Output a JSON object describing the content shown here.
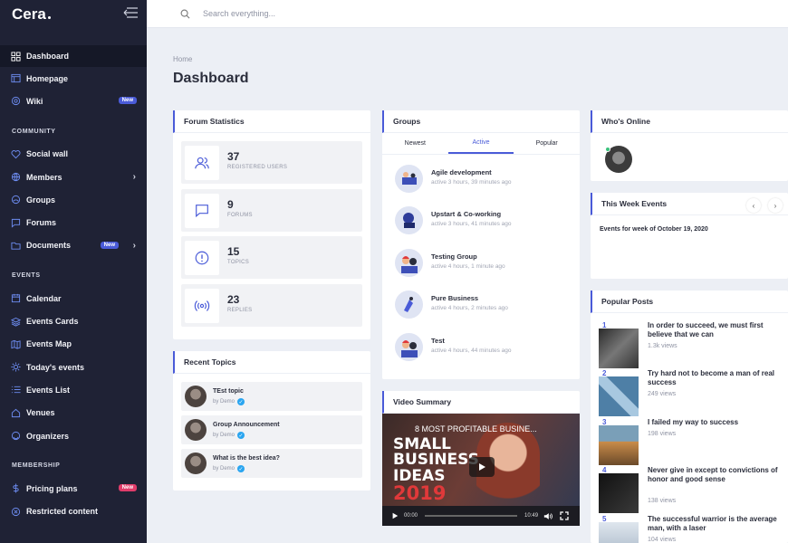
{
  "brand": {
    "name": "Cera"
  },
  "search": {
    "placeholder": "Search everything..."
  },
  "breadcrumb": "Home",
  "page_title": "Dashboard",
  "sidebar": {
    "top": [
      {
        "label": "Dashboard",
        "icon": "grid-icon",
        "active": true
      },
      {
        "label": "Homepage",
        "icon": "browser-icon"
      },
      {
        "label": "Wiki",
        "icon": "globe-icon",
        "badge": "New"
      }
    ],
    "community_title": "COMMUNITY",
    "community": [
      {
        "label": "Social wall",
        "icon": "heart-icon"
      },
      {
        "label": "Members",
        "icon": "globe-icon"
      },
      {
        "label": "Groups",
        "icon": "groups-icon"
      },
      {
        "label": "Forums",
        "icon": "chat-icon"
      },
      {
        "label": "Documents",
        "icon": "folder-icon",
        "badge": "New"
      }
    ],
    "events_title": "EVENTS",
    "events": [
      {
        "label": "Calendar",
        "icon": "calendar-icon"
      },
      {
        "label": "Events Cards",
        "icon": "layers-icon"
      },
      {
        "label": "Events Map",
        "icon": "map-icon"
      },
      {
        "label": "Today's events",
        "icon": "sun-icon"
      },
      {
        "label": "Events List",
        "icon": "list-icon"
      },
      {
        "label": "Venues",
        "icon": "home-icon"
      },
      {
        "label": "Organizers",
        "icon": "user-circle-icon"
      }
    ],
    "membership_title": "MEMBERSHIP",
    "membership": [
      {
        "label": "Pricing plans",
        "icon": "dollar-icon",
        "badge": "New"
      },
      {
        "label": "Restricted content",
        "icon": "close-circle-icon"
      }
    ]
  },
  "forum_stats": {
    "title": "Forum Statistics",
    "items": [
      {
        "value": "37",
        "label": "REGISTERED USERS",
        "icon": "users-icon"
      },
      {
        "value": "9",
        "label": "FORUMS",
        "icon": "chat-icon"
      },
      {
        "value": "15",
        "label": "TOPICS",
        "icon": "alert-circle-icon"
      },
      {
        "value": "23",
        "label": "REPLIES",
        "icon": "broadcast-icon"
      }
    ]
  },
  "recent_topics": {
    "title": "Recent Topics",
    "items": [
      {
        "title": "TEst topic",
        "by": "by Demo"
      },
      {
        "title": "Group Announcement",
        "by": "by Demo"
      },
      {
        "title": "What is the best idea?",
        "by": "by Demo"
      }
    ]
  },
  "groups": {
    "title": "Groups",
    "tabs": [
      "Newest",
      "Active",
      "Popular"
    ],
    "active_tab": "Active",
    "items": [
      {
        "name": "Agile development",
        "meta": "active 3 hours, 39 minutes ago"
      },
      {
        "name": "Upstart & Co-working",
        "meta": "active 3 hours, 41 minutes ago"
      },
      {
        "name": "Testing Group",
        "meta": "active 4 hours, 1 minute ago"
      },
      {
        "name": "Pure Business",
        "meta": "active 4 hours, 2 minutes ago"
      },
      {
        "name": "Test",
        "meta": "active 4 hours, 44 minutes ago"
      }
    ]
  },
  "video": {
    "title": "Video Summary",
    "video_title": "8 MOST PROFITABLE BUSINE...",
    "thumb_line1": "SMALL",
    "thumb_line2": "BUSINESS",
    "thumb_line3": "IDEAS",
    "thumb_year": "2019",
    "current_time": "00:00",
    "duration": "10:49"
  },
  "whos_online": {
    "title": "Who's Online"
  },
  "week_events": {
    "title": "This Week Events",
    "text": "Events for week of October 19, 2020"
  },
  "popular_posts": {
    "title": "Popular Posts",
    "items": [
      {
        "n": "1",
        "title": "In order to succeed, we must first believe that we can",
        "views": "1.3k views"
      },
      {
        "n": "2",
        "title": "Try hard not to become a man of real success",
        "views": "249 views"
      },
      {
        "n": "3",
        "title": "I failed my way to success",
        "views": "198 views"
      },
      {
        "n": "4",
        "title": "Never give in except to convictions of honor and good sense",
        "views": "138 views"
      },
      {
        "n": "5",
        "title": "The successful warrior is the average man, with a laser",
        "views": "104 views"
      }
    ]
  }
}
